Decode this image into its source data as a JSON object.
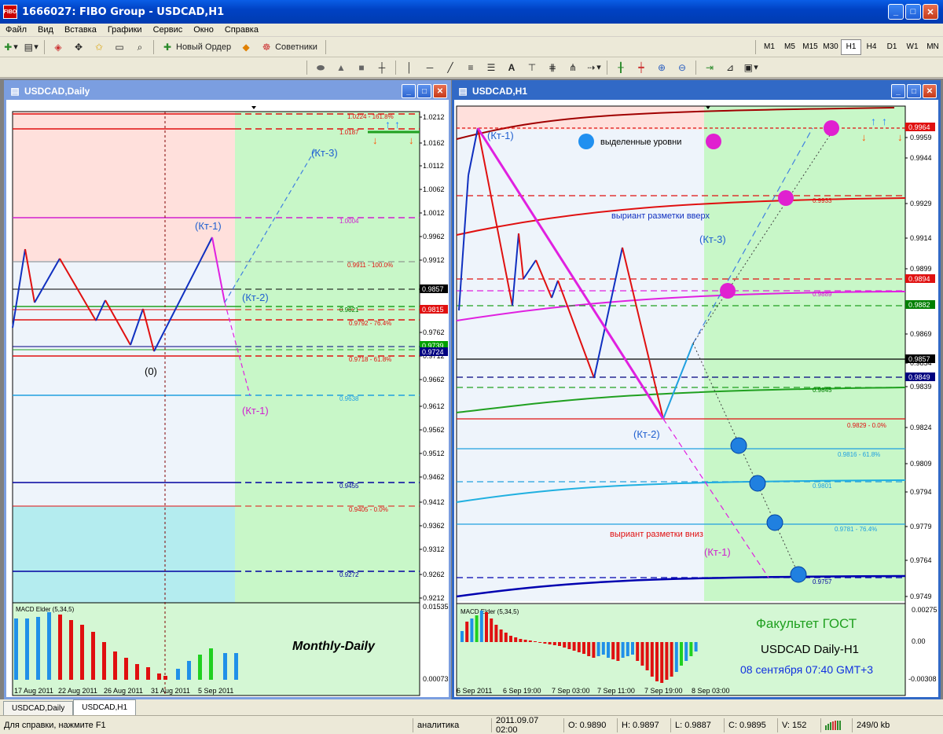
{
  "window": {
    "title": "1666027: FIBO Group - USDCAD,H1",
    "app_icon_text": "FIBO"
  },
  "menu": [
    "Файл",
    "Вид",
    "Вставка",
    "Графики",
    "Сервис",
    "Окно",
    "Справка"
  ],
  "toolbar": {
    "new_order": "Новый Ордер",
    "advisors": "Советники",
    "text_tool": "A",
    "timeframes": [
      "M1",
      "M5",
      "M15",
      "M30",
      "H1",
      "H4",
      "D1",
      "W1",
      "MN"
    ],
    "active_timeframe": "H1"
  },
  "left_chart": {
    "title": "USDCAD,Daily",
    "indicator": "MACD Elder (5,34,5)",
    "caption": "Monthly-Daily",
    "price_axis": [
      "1.0212",
      "1.0162",
      "1.0112",
      "1.0062",
      "1.0012",
      "0.9962",
      "0.9912",
      "0.9762",
      "0.9712",
      "0.9662",
      "0.9612",
      "0.9562",
      "0.9512",
      "0.9462",
      "0.9412",
      "0.9362",
      "0.9312",
      "0.9262",
      "0.9212"
    ],
    "price_tags": [
      {
        "text": "0.9857",
        "bg": "#000000"
      },
      {
        "text": "0.9815",
        "bg": "#e01010"
      },
      {
        "text": "0.9739",
        "bg": "#00a000"
      },
      {
        "text": "0.9724",
        "bg": "#000080"
      }
    ],
    "fib_labels": [
      {
        "text": "1.0224 - 161.8%",
        "color": "#e01010"
      },
      {
        "text": "1.0187",
        "color": "#e01010"
      },
      {
        "text": "1.0004",
        "color": "#d020d0"
      },
      {
        "text": "0.9911 - 100.0%",
        "color": "#e01010"
      },
      {
        "text": "0.9821",
        "color": "#008000"
      },
      {
        "text": "0.9792 - 76.4%",
        "color": "#e01010"
      },
      {
        "text": "0.9718 - 61.8%",
        "color": "#e01010"
      },
      {
        "text": "0.9638",
        "color": "#20a0e0"
      },
      {
        "text": "0.9455",
        "color": "#0000a0"
      },
      {
        "text": "0.9405 - 0.0%",
        "color": "#e01010"
      },
      {
        "text": "0.9272",
        "color": "#0000a0"
      }
    ],
    "point_labels": [
      "(Кт-1)",
      "(Кт-2)",
      "(Кт-3)",
      "(Кт-1)",
      "(0)"
    ],
    "macd_axis": [
      "0.01535",
      "0.00073"
    ],
    "time_axis": [
      "17 Aug 2011",
      "22 Aug 2011",
      "26 Aug 2011",
      "31 Aug 2011",
      "5 Sep 2011"
    ]
  },
  "right_chart": {
    "title": "USDCAD,H1",
    "indicator": "MACD Elder (5,34,5)",
    "legend_text": "выделенные уровни",
    "variant_up": "выриант разметки вверх",
    "variant_down": "выриант разметки вниз",
    "faculty": "Факультет ГОСТ",
    "pair": "USDCAD Daily-H1",
    "date": "08 сентября 07:40 GMT+3",
    "price_axis": [
      "0.9959",
      "0.9944",
      "0.9929",
      "0.9914",
      "0.9899",
      "0.9869",
      "0.9854",
      "0.9839",
      "0.9824",
      "0.9809",
      "0.9794",
      "0.9779",
      "0.9764",
      "0.9749"
    ],
    "price_tags": [
      {
        "text": "0.9964",
        "bg": "#e01010"
      },
      {
        "text": "0.9894",
        "bg": "#e01010"
      },
      {
        "text": "0.9882",
        "bg": "#008000"
      },
      {
        "text": "0.9857",
        "bg": "#000000"
      },
      {
        "text": "0.9849",
        "bg": "#000080"
      }
    ],
    "fib_labels": [
      {
        "text": "0.9933",
        "color": "#e01010"
      },
      {
        "text": "0.9889",
        "color": "#d020d0"
      },
      {
        "text": "0.9845",
        "color": "#008000"
      },
      {
        "text": "0.9829 - 0.0%",
        "color": "#e01010"
      },
      {
        "text": "0.9816 - 61.8%",
        "color": "#20a0e0"
      },
      {
        "text": "0.9801",
        "color": "#20a0e0"
      },
      {
        "text": "0.9781 - 76.4%",
        "color": "#20a0e0"
      },
      {
        "text": "0.9757",
        "color": "#0000a0"
      }
    ],
    "point_labels": [
      "(Кт-1)",
      "(Кт-3)",
      "(Кт-2)",
      "(Кт-1)"
    ],
    "macd_axis": [
      "0.00275",
      "0.00",
      "-0.00308"
    ],
    "time_axis": [
      "6 Sep 2011",
      "6 Sep 19:00",
      "7 Sep 03:00",
      "7 Sep 11:00",
      "7 Sep 19:00",
      "8 Sep 03:00"
    ]
  },
  "tabs": [
    "USDCAD,Daily",
    "USDCAD,H1"
  ],
  "active_tab": "USDCAD,H1",
  "status": {
    "help": "Для справки, нажмите F1",
    "profile": "аналитика",
    "datetime": "2011.09.07 02:00",
    "open": "O: 0.9890",
    "high": "H: 0.9897",
    "low": "L: 0.9887",
    "close": "C: 0.9895",
    "volume": "V: 152",
    "traffic": "249/0 kb"
  }
}
